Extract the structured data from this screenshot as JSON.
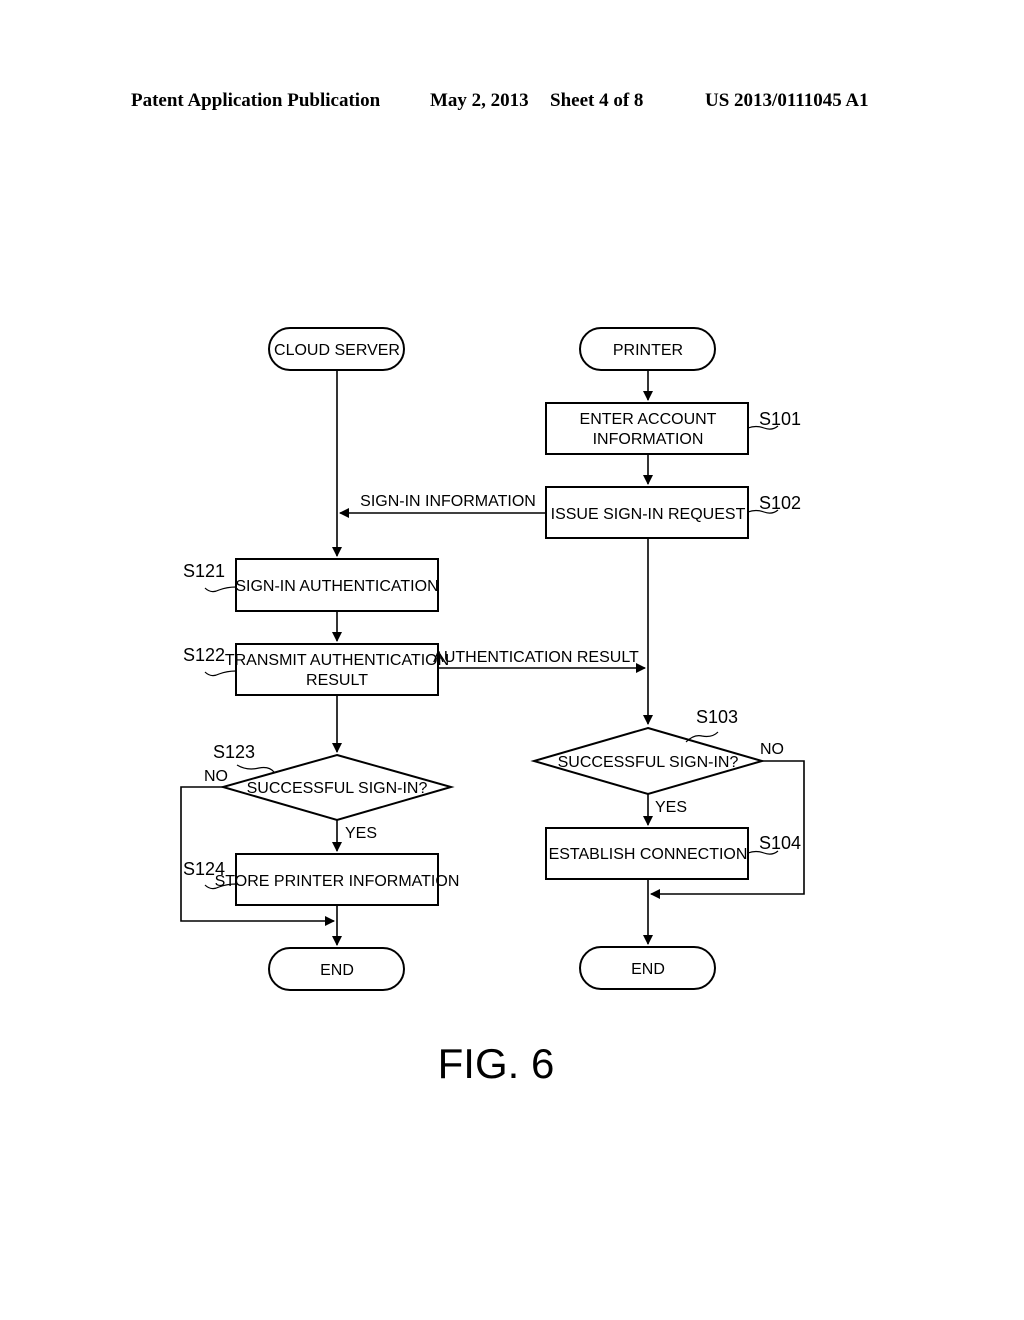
{
  "header": {
    "publication": "Patent Application Publication",
    "date": "May 2, 2013",
    "sheet": "Sheet 4 of 8",
    "number": "US 2013/0111045 A1"
  },
  "figure_label": "FIG. 6",
  "cloud_server": {
    "start": "CLOUD SERVER",
    "s121": {
      "ref": "S121",
      "text": "SIGN-IN AUTHENTICATION"
    },
    "s122": {
      "ref": "S122",
      "line1": "TRANSMIT AUTHENTICATION",
      "line2": "RESULT"
    },
    "s123": {
      "ref": "S123",
      "text": "SUCCESSFUL SIGN-IN?",
      "no": "NO",
      "yes": "YES"
    },
    "s124": {
      "ref": "S124",
      "text": "STORE PRINTER INFORMATION"
    },
    "end": "END"
  },
  "printer": {
    "start": "PRINTER",
    "s101": {
      "ref": "S101",
      "line1": "ENTER ACCOUNT",
      "line2": "INFORMATION"
    },
    "s102": {
      "ref": "S102",
      "text": "ISSUE SIGN-IN REQUEST"
    },
    "s103": {
      "ref": "S103",
      "text": "SUCCESSFUL SIGN-IN?",
      "no": "NO",
      "yes": "YES"
    },
    "s104": {
      "ref": "S104",
      "text": "ESTABLISH CONNECTION"
    },
    "end": "END"
  },
  "messages": {
    "sign_in_information": "SIGN-IN INFORMATION",
    "authentication_result": "AUTHENTICATION RESULT"
  }
}
